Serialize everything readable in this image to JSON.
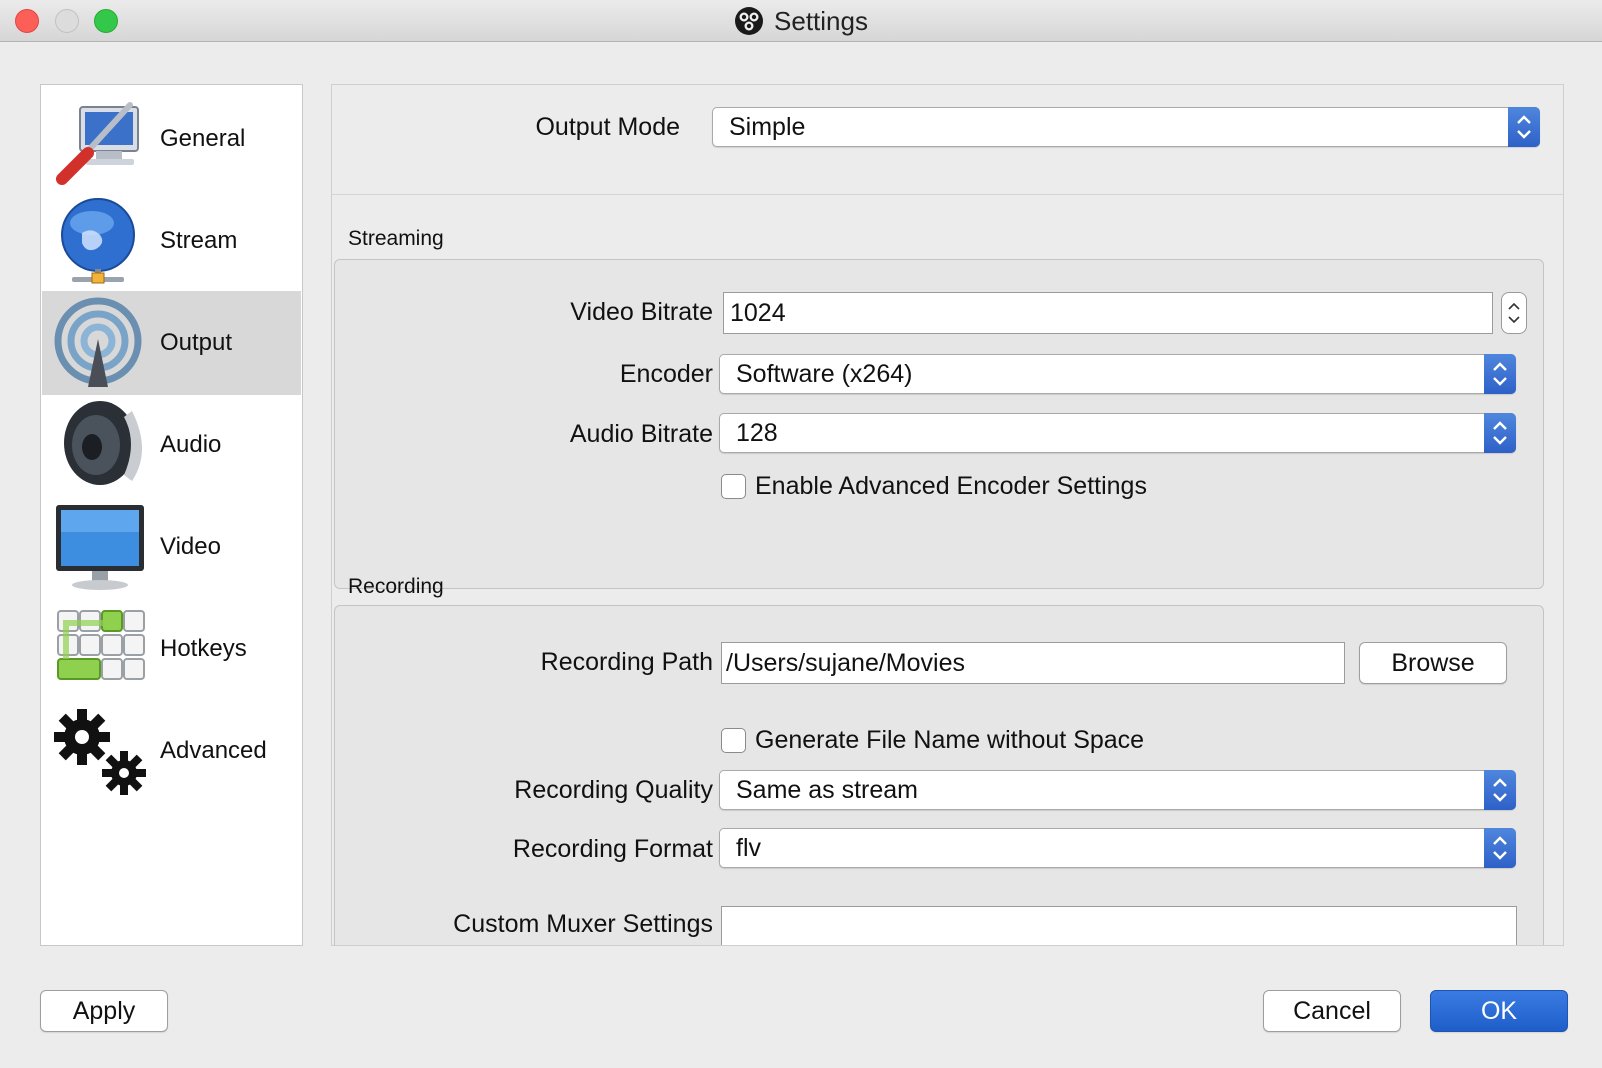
{
  "window": {
    "title": "Settings"
  },
  "sidebar": {
    "items": [
      {
        "label": "General",
        "icon": "general-tools-icon"
      },
      {
        "label": "Stream",
        "icon": "stream-globe-icon"
      },
      {
        "label": "Output",
        "icon": "output-broadcast-icon",
        "selected": true
      },
      {
        "label": "Audio",
        "icon": "audio-speaker-icon"
      },
      {
        "label": "Video",
        "icon": "video-monitor-icon"
      },
      {
        "label": "Hotkeys",
        "icon": "hotkeys-keyboard-icon"
      },
      {
        "label": "Advanced",
        "icon": "advanced-gears-icon"
      }
    ]
  },
  "output_mode": {
    "label": "Output Mode",
    "value": "Simple"
  },
  "streaming": {
    "title": "Streaming",
    "video_bitrate": {
      "label": "Video Bitrate",
      "value": "1024"
    },
    "encoder": {
      "label": "Encoder",
      "value": "Software (x264)"
    },
    "audio_bitrate": {
      "label": "Audio Bitrate",
      "value": "128"
    },
    "advanced_encoder": {
      "label": "Enable Advanced Encoder Settings",
      "checked": false
    }
  },
  "recording": {
    "title": "Recording",
    "path": {
      "label": "Recording Path",
      "value": "/Users/sujane/Movies",
      "browse_label": "Browse"
    },
    "no_space": {
      "label": "Generate File Name without Space",
      "checked": false
    },
    "quality": {
      "label": "Recording Quality",
      "value": "Same as stream"
    },
    "format": {
      "label": "Recording Format",
      "value": "flv"
    },
    "muxer": {
      "label": "Custom Muxer Settings",
      "value": ""
    }
  },
  "footer": {
    "apply_label": "Apply",
    "cancel_label": "Cancel",
    "ok_label": "OK"
  },
  "colors": {
    "accent": "#2e61c8",
    "close": "#fc5f57",
    "maximize": "#34c84a"
  }
}
